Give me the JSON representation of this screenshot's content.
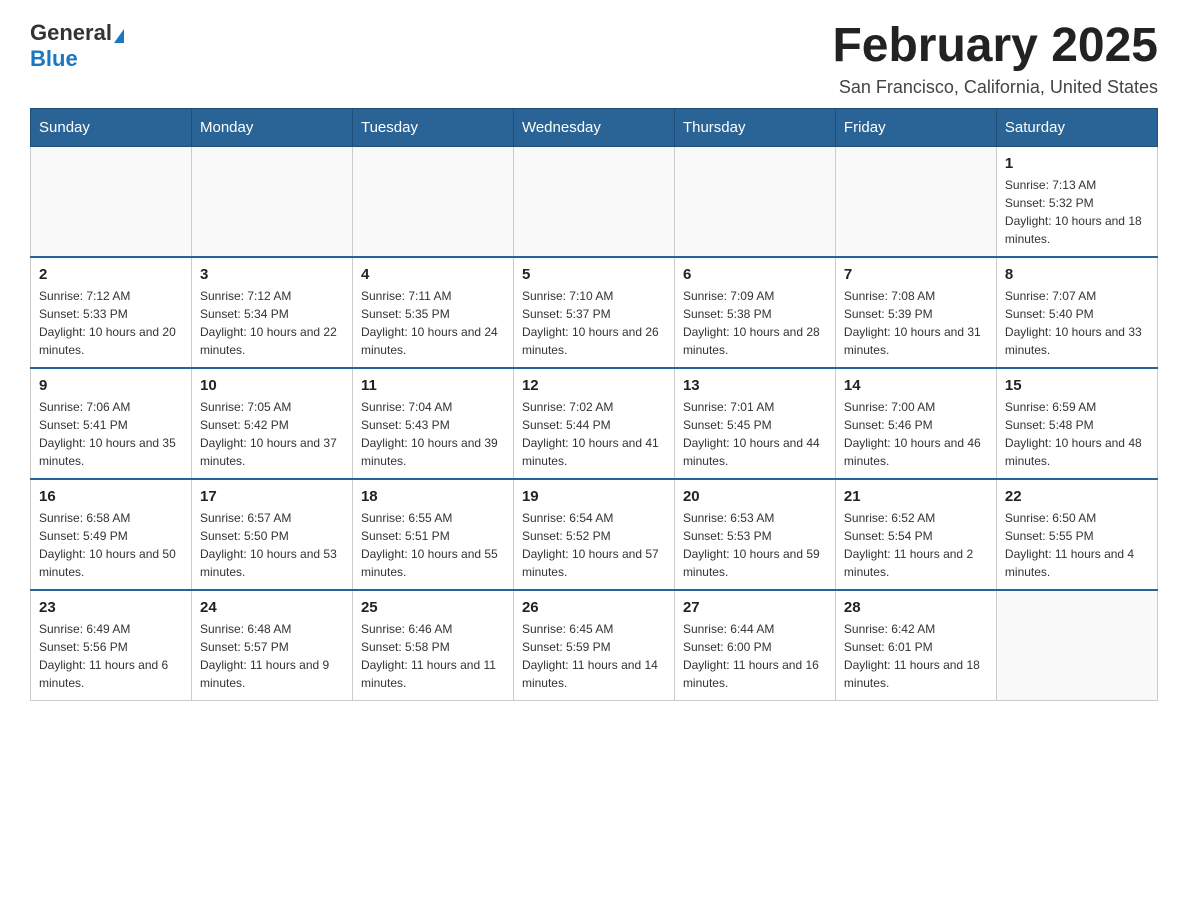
{
  "header": {
    "logo_general": "General",
    "logo_blue": "Blue",
    "month_title": "February 2025",
    "location": "San Francisco, California, United States"
  },
  "days_of_week": [
    "Sunday",
    "Monday",
    "Tuesday",
    "Wednesday",
    "Thursday",
    "Friday",
    "Saturday"
  ],
  "weeks": [
    [
      {
        "day": "",
        "info": ""
      },
      {
        "day": "",
        "info": ""
      },
      {
        "day": "",
        "info": ""
      },
      {
        "day": "",
        "info": ""
      },
      {
        "day": "",
        "info": ""
      },
      {
        "day": "",
        "info": ""
      },
      {
        "day": "1",
        "info": "Sunrise: 7:13 AM\nSunset: 5:32 PM\nDaylight: 10 hours and 18 minutes."
      }
    ],
    [
      {
        "day": "2",
        "info": "Sunrise: 7:12 AM\nSunset: 5:33 PM\nDaylight: 10 hours and 20 minutes."
      },
      {
        "day": "3",
        "info": "Sunrise: 7:12 AM\nSunset: 5:34 PM\nDaylight: 10 hours and 22 minutes."
      },
      {
        "day": "4",
        "info": "Sunrise: 7:11 AM\nSunset: 5:35 PM\nDaylight: 10 hours and 24 minutes."
      },
      {
        "day": "5",
        "info": "Sunrise: 7:10 AM\nSunset: 5:37 PM\nDaylight: 10 hours and 26 minutes."
      },
      {
        "day": "6",
        "info": "Sunrise: 7:09 AM\nSunset: 5:38 PM\nDaylight: 10 hours and 28 minutes."
      },
      {
        "day": "7",
        "info": "Sunrise: 7:08 AM\nSunset: 5:39 PM\nDaylight: 10 hours and 31 minutes."
      },
      {
        "day": "8",
        "info": "Sunrise: 7:07 AM\nSunset: 5:40 PM\nDaylight: 10 hours and 33 minutes."
      }
    ],
    [
      {
        "day": "9",
        "info": "Sunrise: 7:06 AM\nSunset: 5:41 PM\nDaylight: 10 hours and 35 minutes."
      },
      {
        "day": "10",
        "info": "Sunrise: 7:05 AM\nSunset: 5:42 PM\nDaylight: 10 hours and 37 minutes."
      },
      {
        "day": "11",
        "info": "Sunrise: 7:04 AM\nSunset: 5:43 PM\nDaylight: 10 hours and 39 minutes."
      },
      {
        "day": "12",
        "info": "Sunrise: 7:02 AM\nSunset: 5:44 PM\nDaylight: 10 hours and 41 minutes."
      },
      {
        "day": "13",
        "info": "Sunrise: 7:01 AM\nSunset: 5:45 PM\nDaylight: 10 hours and 44 minutes."
      },
      {
        "day": "14",
        "info": "Sunrise: 7:00 AM\nSunset: 5:46 PM\nDaylight: 10 hours and 46 minutes."
      },
      {
        "day": "15",
        "info": "Sunrise: 6:59 AM\nSunset: 5:48 PM\nDaylight: 10 hours and 48 minutes."
      }
    ],
    [
      {
        "day": "16",
        "info": "Sunrise: 6:58 AM\nSunset: 5:49 PM\nDaylight: 10 hours and 50 minutes."
      },
      {
        "day": "17",
        "info": "Sunrise: 6:57 AM\nSunset: 5:50 PM\nDaylight: 10 hours and 53 minutes."
      },
      {
        "day": "18",
        "info": "Sunrise: 6:55 AM\nSunset: 5:51 PM\nDaylight: 10 hours and 55 minutes."
      },
      {
        "day": "19",
        "info": "Sunrise: 6:54 AM\nSunset: 5:52 PM\nDaylight: 10 hours and 57 minutes."
      },
      {
        "day": "20",
        "info": "Sunrise: 6:53 AM\nSunset: 5:53 PM\nDaylight: 10 hours and 59 minutes."
      },
      {
        "day": "21",
        "info": "Sunrise: 6:52 AM\nSunset: 5:54 PM\nDaylight: 11 hours and 2 minutes."
      },
      {
        "day": "22",
        "info": "Sunrise: 6:50 AM\nSunset: 5:55 PM\nDaylight: 11 hours and 4 minutes."
      }
    ],
    [
      {
        "day": "23",
        "info": "Sunrise: 6:49 AM\nSunset: 5:56 PM\nDaylight: 11 hours and 6 minutes."
      },
      {
        "day": "24",
        "info": "Sunrise: 6:48 AM\nSunset: 5:57 PM\nDaylight: 11 hours and 9 minutes."
      },
      {
        "day": "25",
        "info": "Sunrise: 6:46 AM\nSunset: 5:58 PM\nDaylight: 11 hours and 11 minutes."
      },
      {
        "day": "26",
        "info": "Sunrise: 6:45 AM\nSunset: 5:59 PM\nDaylight: 11 hours and 14 minutes."
      },
      {
        "day": "27",
        "info": "Sunrise: 6:44 AM\nSunset: 6:00 PM\nDaylight: 11 hours and 16 minutes."
      },
      {
        "day": "28",
        "info": "Sunrise: 6:42 AM\nSunset: 6:01 PM\nDaylight: 11 hours and 18 minutes."
      },
      {
        "day": "",
        "info": ""
      }
    ]
  ]
}
